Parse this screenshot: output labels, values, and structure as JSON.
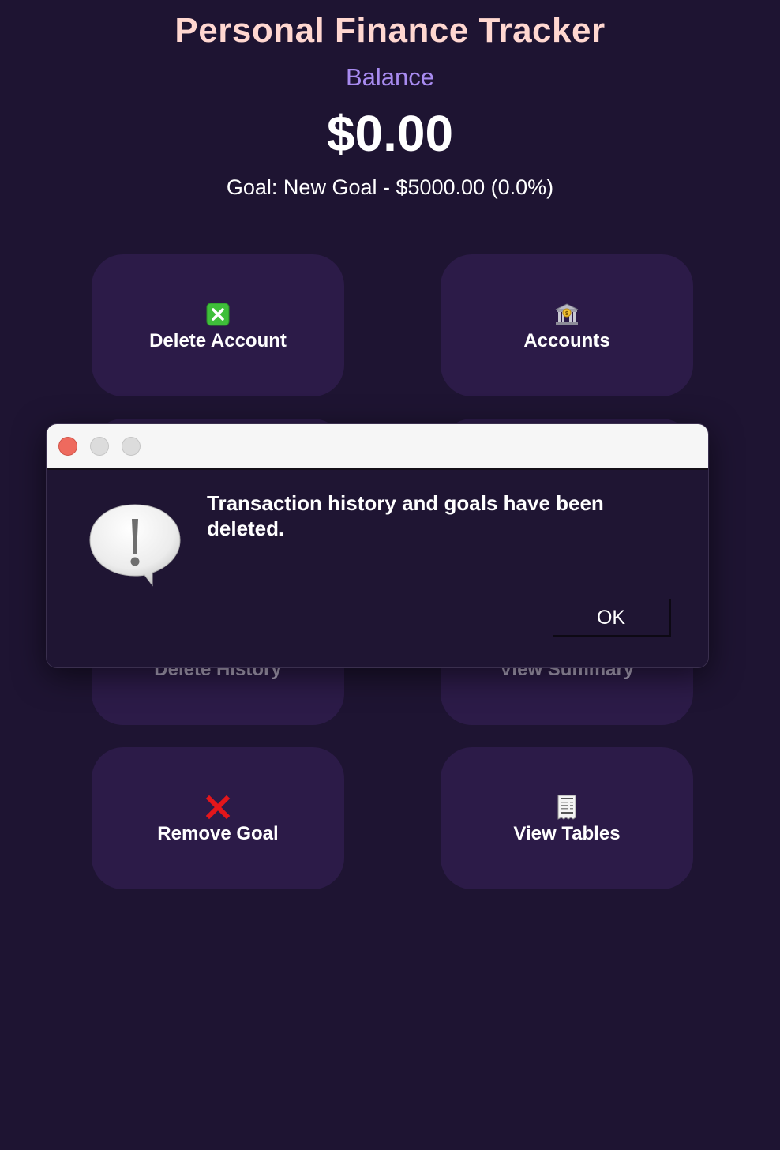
{
  "app": {
    "title": "Personal Finance Tracker",
    "balance_label": "Balance",
    "balance_value": "$0.00",
    "goal_text": "Goal: New Goal - $5000.00 (0.0%)"
  },
  "tiles": [
    {
      "label": "Delete Account",
      "icon": "cross-mark-button-icon"
    },
    {
      "label": "Accounts",
      "icon": "bank-icon"
    },
    {
      "label": "Delete History",
      "icon": ""
    },
    {
      "label": "View Summary",
      "icon": ""
    },
    {
      "label": "Remove Goal",
      "icon": "cross-mark-icon"
    },
    {
      "label": "View Tables",
      "icon": "receipt-icon"
    }
  ],
  "dialog": {
    "message": "Transaction history and goals have been deleted.",
    "ok_label": "OK",
    "icon": "alert-speech-bubble-icon"
  },
  "colors": {
    "background": "#1e1432",
    "tile": "#2c1b48",
    "title": "#ffd7d0",
    "balance_label": "#a88bf0"
  }
}
